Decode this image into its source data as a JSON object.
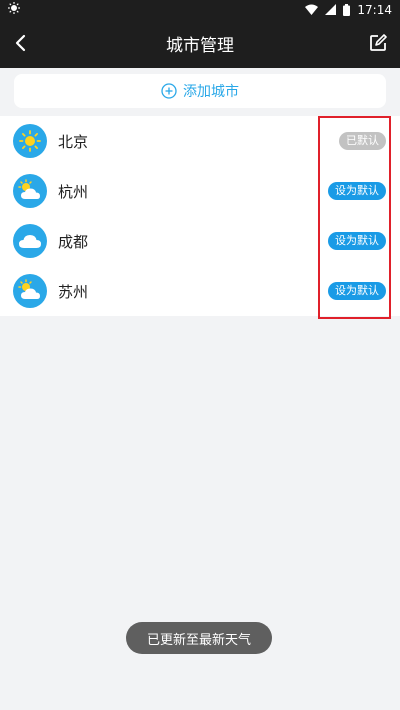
{
  "status_bar": {
    "time": "17:14",
    "left_icon": "brightness-icon",
    "wifi_icon": "wifi-icon",
    "signal_icon": "signal-icon",
    "battery_icon": "battery-icon"
  },
  "app_bar": {
    "title": "城市管理",
    "back_icon": "chevron-left-icon",
    "edit_icon": "edit-icon"
  },
  "add_city": {
    "label": "添加城市",
    "icon": "plus-circle-icon"
  },
  "cities": [
    {
      "name": "北京",
      "weather": "sunny",
      "button": "已默认",
      "is_default": true
    },
    {
      "name": "杭州",
      "weather": "partly-cloudy",
      "button": "设为默认",
      "is_default": false
    },
    {
      "name": "成都",
      "weather": "cloudy",
      "button": "设为默认",
      "is_default": false
    },
    {
      "name": "苏州",
      "weather": "partly-cloudy",
      "button": "设为默认",
      "is_default": false
    }
  ],
  "toast": {
    "text": "已更新至最新天气"
  },
  "colors": {
    "accent": "#2aa8e8",
    "button_blue": "#1a9be6",
    "default_gray": "#c2c2c2",
    "bar_dark": "#1e1e1e",
    "highlight": "#e0202a"
  }
}
